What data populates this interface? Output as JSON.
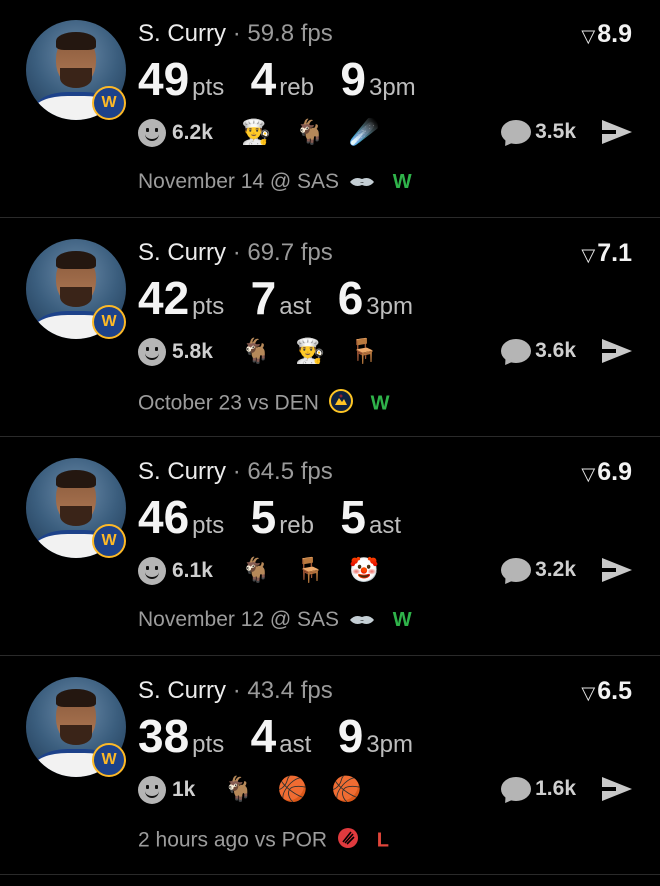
{
  "feed": [
    {
      "player": "S. Curry",
      "fps": "59.8 fps",
      "rating": "8.9",
      "stats": [
        {
          "value": "49",
          "unit": "pts"
        },
        {
          "value": "4",
          "unit": "reb"
        },
        {
          "value": "9",
          "unit": "3pm"
        }
      ],
      "likes": "6.2k",
      "reaction_emojis": [
        "👨‍🍳",
        "🐐",
        "☄️"
      ],
      "comments": "3.5k",
      "date_label": "November 14 @ SAS",
      "opponent_icon": "spurs-logo-icon",
      "result": "W"
    },
    {
      "player": "S. Curry",
      "fps": "69.7 fps",
      "rating": "7.1",
      "stats": [
        {
          "value": "42",
          "unit": "pts"
        },
        {
          "value": "7",
          "unit": "ast"
        },
        {
          "value": "6",
          "unit": "3pm"
        }
      ],
      "likes": "5.8k",
      "reaction_emojis": [
        "🐐",
        "👨‍🍳",
        "🪑"
      ],
      "comments": "3.6k",
      "date_label": "October 23 vs DEN",
      "opponent_icon": "nuggets-logo-icon",
      "result": "W"
    },
    {
      "player": "S. Curry",
      "fps": "64.5 fps",
      "rating": "6.9",
      "stats": [
        {
          "value": "46",
          "unit": "pts"
        },
        {
          "value": "5",
          "unit": "reb"
        },
        {
          "value": "5",
          "unit": "ast"
        }
      ],
      "likes": "6.1k",
      "reaction_emojis": [
        "🐐",
        "🪑",
        "🤡"
      ],
      "comments": "3.2k",
      "date_label": "November 12 @ SAS",
      "opponent_icon": "spurs-logo-icon",
      "result": "W"
    },
    {
      "player": "S. Curry",
      "fps": "43.4 fps",
      "rating": "6.5",
      "stats": [
        {
          "value": "38",
          "unit": "pts"
        },
        {
          "value": "4",
          "unit": "ast"
        },
        {
          "value": "9",
          "unit": "3pm"
        }
      ],
      "likes": "1k",
      "reaction_emojis": [
        "🐐",
        "🏀",
        "🏀"
      ],
      "comments": "1.6k",
      "date_label": "2 hours ago vs POR",
      "opponent_icon": "blazers-logo-icon",
      "result": "L"
    }
  ],
  "colors": {
    "background": "#000000",
    "win": "#2fb34a",
    "loss": "#e0453a",
    "warriors_blue": "#1d428a",
    "warriors_gold": "#fdb927"
  }
}
